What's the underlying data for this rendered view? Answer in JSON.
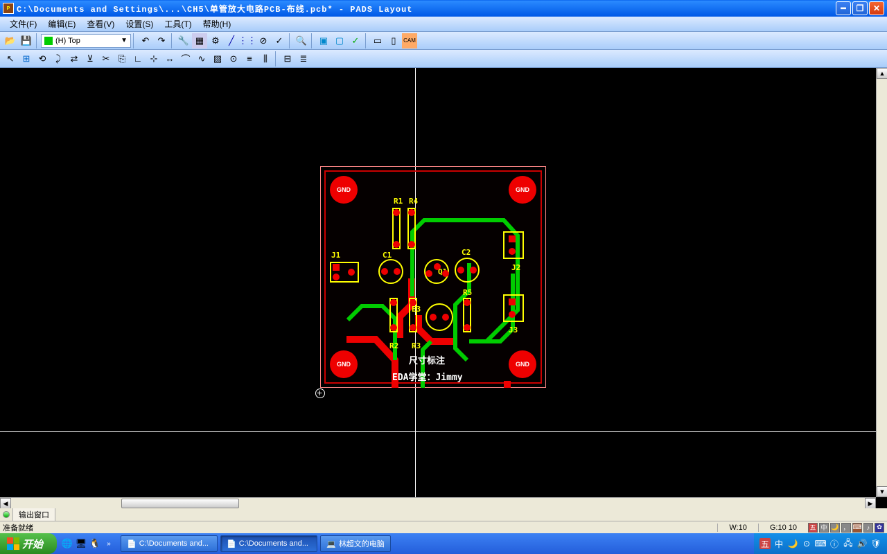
{
  "titlebar": {
    "path": "C:\\Documents and Settings\\...\\CH5\\单管放大电路PCB-布线.pcb* - PADS Layout"
  },
  "menu": {
    "file": "文件(F)",
    "edit": "编辑(E)",
    "view": "查看(V)",
    "setup": "设置(S)",
    "tools": "工具(T)",
    "help": "帮助(H)"
  },
  "layer": {
    "label": "(H) Top"
  },
  "pcb": {
    "holes": [
      "GND",
      "GND",
      "GND",
      "GND"
    ],
    "refs": {
      "r1": "R1",
      "r4": "R4",
      "j1": "J1",
      "c1": "C1",
      "c2": "C2",
      "q1": "Q1",
      "j2": "J2",
      "r5": "R5",
      "r2": "R2",
      "r3": "R3",
      "j3": "J3",
      "e3": "E3"
    },
    "text1": "尺寸标注",
    "text2": "EDA学堂：Jimmy"
  },
  "output": {
    "tab": "输出窗口"
  },
  "status": {
    "ready": "准备就绪",
    "w": "W:10",
    "g": "G:10 10"
  },
  "taskbar": {
    "start": "开始",
    "task1": "C:\\Documents and...",
    "task2": "C:\\Documents and...",
    "task3": "林超文的电脑"
  },
  "tray": {
    "ime": "五",
    "ime2": "中"
  }
}
